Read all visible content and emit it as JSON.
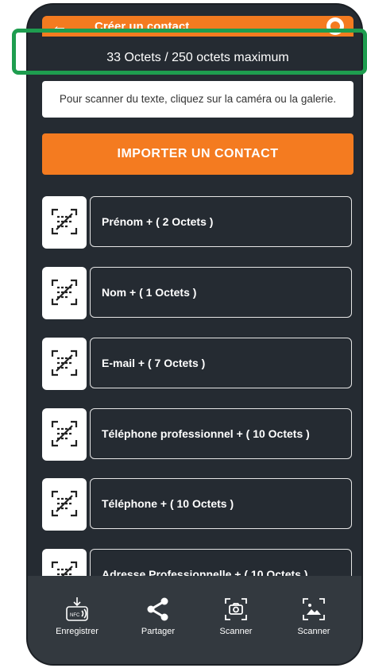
{
  "topbar": {
    "title": "Créer un contact",
    "back_icon": "arrow-left-icon",
    "right_icon": "toggle-icon"
  },
  "counter": {
    "text": "33 Octets / 250 octets maximum"
  },
  "hint": {
    "text": "Pour scanner du texte, cliquez sur la caméra ou la galerie."
  },
  "import_button": {
    "label": "IMPORTER UN CONTACT"
  },
  "fields": [
    {
      "label": "Prénom + ( 2 Octets )"
    },
    {
      "label": "Nom + ( 1 Octets )"
    },
    {
      "label": "E-mail + ( 7 Octets )"
    },
    {
      "label": "Téléphone professionnel + ( 10 Octets )"
    },
    {
      "label": "Téléphone  + ( 10 Octets )"
    },
    {
      "label": "Adresse Professionnelle + ( 10 Octets )"
    }
  ],
  "bottom_nav": [
    {
      "label": "Enregistrer",
      "icon": "nfc-icon"
    },
    {
      "label": "Partager",
      "icon": "share-icon"
    },
    {
      "label": "Scanner",
      "icon": "camera-scan-icon"
    },
    {
      "label": "Scanner",
      "icon": "gallery-scan-icon"
    }
  ],
  "colors": {
    "accent": "#f47b20",
    "background": "#252b32",
    "highlight": "#1e9d4f"
  }
}
